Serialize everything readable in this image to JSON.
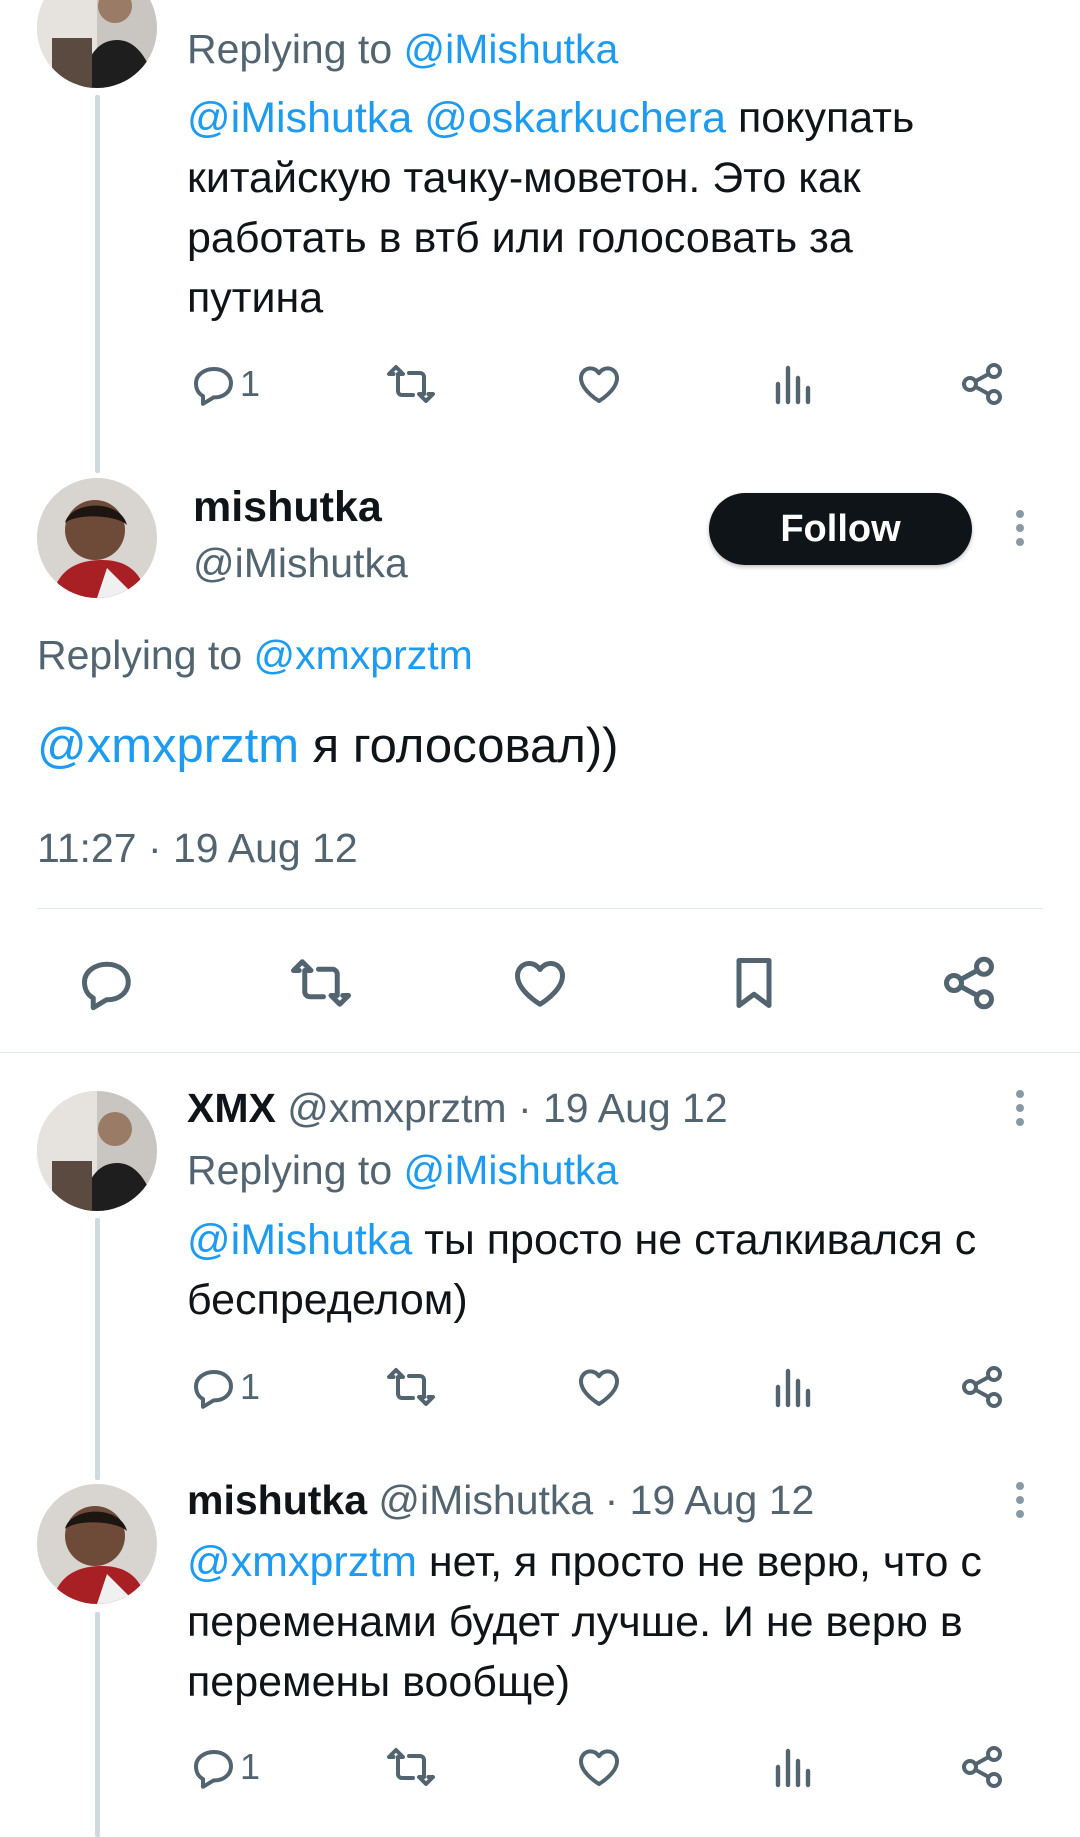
{
  "tweet1": {
    "replying_prefix": "Replying to ",
    "replying_handle": "@iMishutka",
    "mention1": "@iMishutka",
    "mention2": "@oskarkuchera",
    "text_line1": " покупать",
    "text_line2": "китайскую тачку-моветон. Это как",
    "text_line3": "работать в втб или голосовать за",
    "text_line4": "путина",
    "reply_count": "1"
  },
  "main_tweet": {
    "display_name": "mishutka",
    "handle": "@iMishutka",
    "follow_label": "Follow",
    "replying_prefix": "Replying to ",
    "replying_handle": "@xmxprztm",
    "mention": "@xmxprztm",
    "text": " я голосовал))",
    "timestamp": "11:27 · 19 Aug 12"
  },
  "reply1": {
    "display_name": "XMX",
    "handle": "@xmxprztm",
    "date": " · 19 Aug 12",
    "replying_prefix": "Replying to ",
    "replying_handle": "@iMishutka",
    "mention": "@iMishutka",
    "text_line1": " ты просто не сталкивался с",
    "text_line2": "беспределом)",
    "reply_count": "1"
  },
  "reply2": {
    "display_name": "mishutka",
    "handle": "@iMishutka",
    "date": " · 19 Aug 12",
    "mention": "@xmxprztm",
    "text_line1": " нет, я просто не верю, что с",
    "text_line2": "переменами будет лучше. И не верю в",
    "text_line3": "перемены вообще)",
    "reply_count": "1"
  },
  "icons": [
    "reply-icon",
    "retweet-icon",
    "like-icon",
    "views-icon",
    "share-icon",
    "bookmark-icon",
    "more-icon"
  ],
  "colors": {
    "link": "#1d9bf0",
    "text": "#0f1419",
    "muted": "#536471",
    "line": "#cfd9de"
  }
}
